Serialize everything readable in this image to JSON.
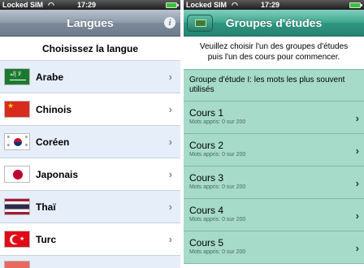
{
  "left": {
    "status": {
      "carrier": "Locked SIM",
      "wifi_icon": "wifi-icon",
      "time": "17:29"
    },
    "nav": {
      "title": "Langues",
      "info_label": "i"
    },
    "subtitle": "Choisissez la langue",
    "languages": [
      {
        "name": "Arabe",
        "flag": "flag-saudi-arabia",
        "flag_text": "لا إله"
      },
      {
        "name": "Chinois",
        "flag": "flag-china"
      },
      {
        "name": "Coréen",
        "flag": "flag-korea"
      },
      {
        "name": "Japonais",
        "flag": "flag-japan"
      },
      {
        "name": "Thaï",
        "flag": "flag-thailand"
      },
      {
        "name": "Turc",
        "flag": "flag-turkey"
      }
    ],
    "chevron": "›"
  },
  "right": {
    "status": {
      "carrier": "Locked SIM",
      "wifi_icon": "wifi-icon",
      "time": "17:29"
    },
    "nav": {
      "title": "Groupes d'études"
    },
    "instructions": "Veuillez choisir l'un des groupes d'études puis l'un des cours pour commencer.",
    "group_header": "Groupe d'étude I: les mots les plus souvent utilisés",
    "courses": [
      {
        "title": "Cours 1",
        "progress": "Mots appris: 0 sur 200"
      },
      {
        "title": "Cours 2",
        "progress": "Mots appris: 0 sur 200"
      },
      {
        "title": "Cours 3",
        "progress": "Mots appris: 0 sur 200"
      },
      {
        "title": "Cours 4",
        "progress": "Mots appris: 0 sur 200"
      },
      {
        "title": "Cours 5",
        "progress": "Mots appris: 0 sur 200"
      }
    ],
    "chevron": "›"
  },
  "colors": {
    "nav_grey": "#7d8a9b",
    "nav_teal": "#2f9580",
    "row_alt": "#e6eefa",
    "course_bg": "#a6dbc9"
  }
}
